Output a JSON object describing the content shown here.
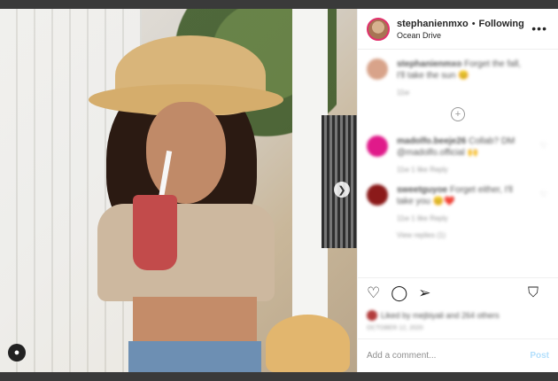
{
  "post": {
    "username": "stephanienmxo",
    "follow_separator": "•",
    "follow_state": "Following",
    "location": "Ocean Drive",
    "more_icon": "more-horizontal-icon"
  },
  "comments": [
    {
      "username": "stephanienmxo",
      "text": "Forget the fall, I'll take the sun",
      "emoji": "😊",
      "meta": "11w",
      "avatar_color": "#d8a38a"
    },
    {
      "username": "madolfo.beeje26",
      "text": "Collab? DM @madolfo.official",
      "emoji": "🙌",
      "meta": "11w  1 like  Reply",
      "avatar_color": "#e01a8a"
    },
    {
      "username": "sweetguyoe",
      "text": "Forget either, I'll take you",
      "emoji": "😊❤️",
      "meta": "11w  1 like  Reply",
      "avatar_color": "#8b1a1a",
      "replies": "View replies (1)"
    }
  ],
  "likes_text": "Liked by mejbiyali and 264 others",
  "date_text": "October 12, 2020",
  "add_comment_placeholder": "Add a comment...",
  "post_button": "Post",
  "colors": {
    "link_blue": "#b2dffc",
    "story_ring": "#e1306c",
    "backdrop": "#3a3a3a"
  }
}
